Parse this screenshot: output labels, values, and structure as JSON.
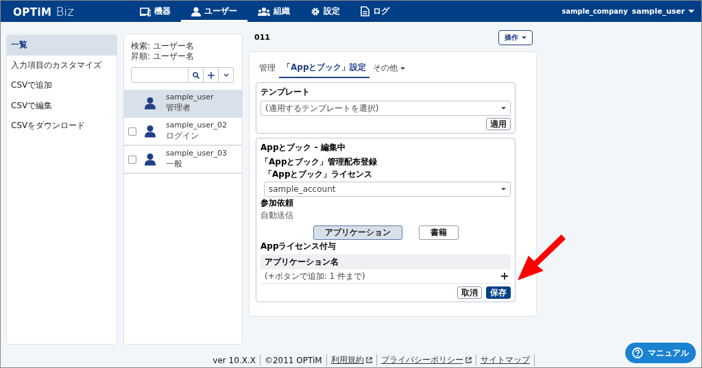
{
  "header": {
    "logo": "OPTiM",
    "logo_suffix": "Biz",
    "nav": [
      {
        "kind": "device",
        "label": "機器",
        "selected": false
      },
      {
        "kind": "user",
        "label": "ユーザー",
        "selected": true
      },
      {
        "kind": "org",
        "label": "組織",
        "selected": false
      },
      {
        "kind": "gear",
        "label": "設定",
        "selected": false
      },
      {
        "kind": "doc",
        "label": "ログ",
        "selected": false
      }
    ],
    "company": "sample_company",
    "user": "sample_user"
  },
  "sidebar": {
    "items": [
      {
        "label": "一覧",
        "selected": true
      },
      {
        "label": "入力項目のカスタマイズ",
        "selected": false
      },
      {
        "label": "CSVで追加",
        "selected": false
      },
      {
        "label": "CSVで編集",
        "selected": false
      },
      {
        "label": "CSVをダウンロード",
        "selected": false
      }
    ]
  },
  "user_list": {
    "search_info": "検索: ユーザー名",
    "sort_info": "昇順: ユーザー名",
    "users": [
      {
        "name": "sample_user",
        "role": "管理者",
        "selected": true
      },
      {
        "name": "sample_user_02",
        "role": "ログイン",
        "selected": false
      },
      {
        "name": "sample_user_03",
        "role": "一般",
        "selected": false
      }
    ]
  },
  "detail": {
    "title": "011",
    "action_button": "操作",
    "tabs": [
      {
        "label": "管理",
        "selected": false,
        "kind": "plain"
      },
      {
        "label": "「Appとブック」設定",
        "selected": true,
        "kind": "plain"
      },
      {
        "label": "その他",
        "selected": false,
        "kind": "dropdown"
      }
    ],
    "template": {
      "title": "テンプレート",
      "select": "(適用するテンプレートを選択)",
      "apply_button": "適用"
    },
    "app_section": {
      "title": "Appとブック - 編集中",
      "subtitle": "「Appとブック」管理配布登録",
      "license_label": "「Appとブック」ライセンス",
      "license_value": "sample_account",
      "invite_label": "参加依頼",
      "invite_value": "自動送信",
      "toggles": [
        {
          "label": "アプリケーション",
          "selected": true
        },
        {
          "label": "書籍",
          "selected": false
        }
      ],
      "grant_label": "Appライセンス付与",
      "table_header": "アプリケーション名",
      "table_hint": "(+ボタンで追加: 1 件まで)",
      "cancel_button": "取消",
      "save_button": "保存"
    }
  },
  "footer": {
    "items": [
      {
        "label": "ver 10.X.X",
        "kind": "text"
      },
      {
        "label": "©2011 OPTiM",
        "kind": "text"
      },
      {
        "label": "利用規約",
        "kind": "external"
      },
      {
        "label": "プライバシーポリシー",
        "kind": "external"
      },
      {
        "label": "サイトマップ",
        "kind": "link"
      }
    ]
  },
  "manual_button": "マニュアル"
}
